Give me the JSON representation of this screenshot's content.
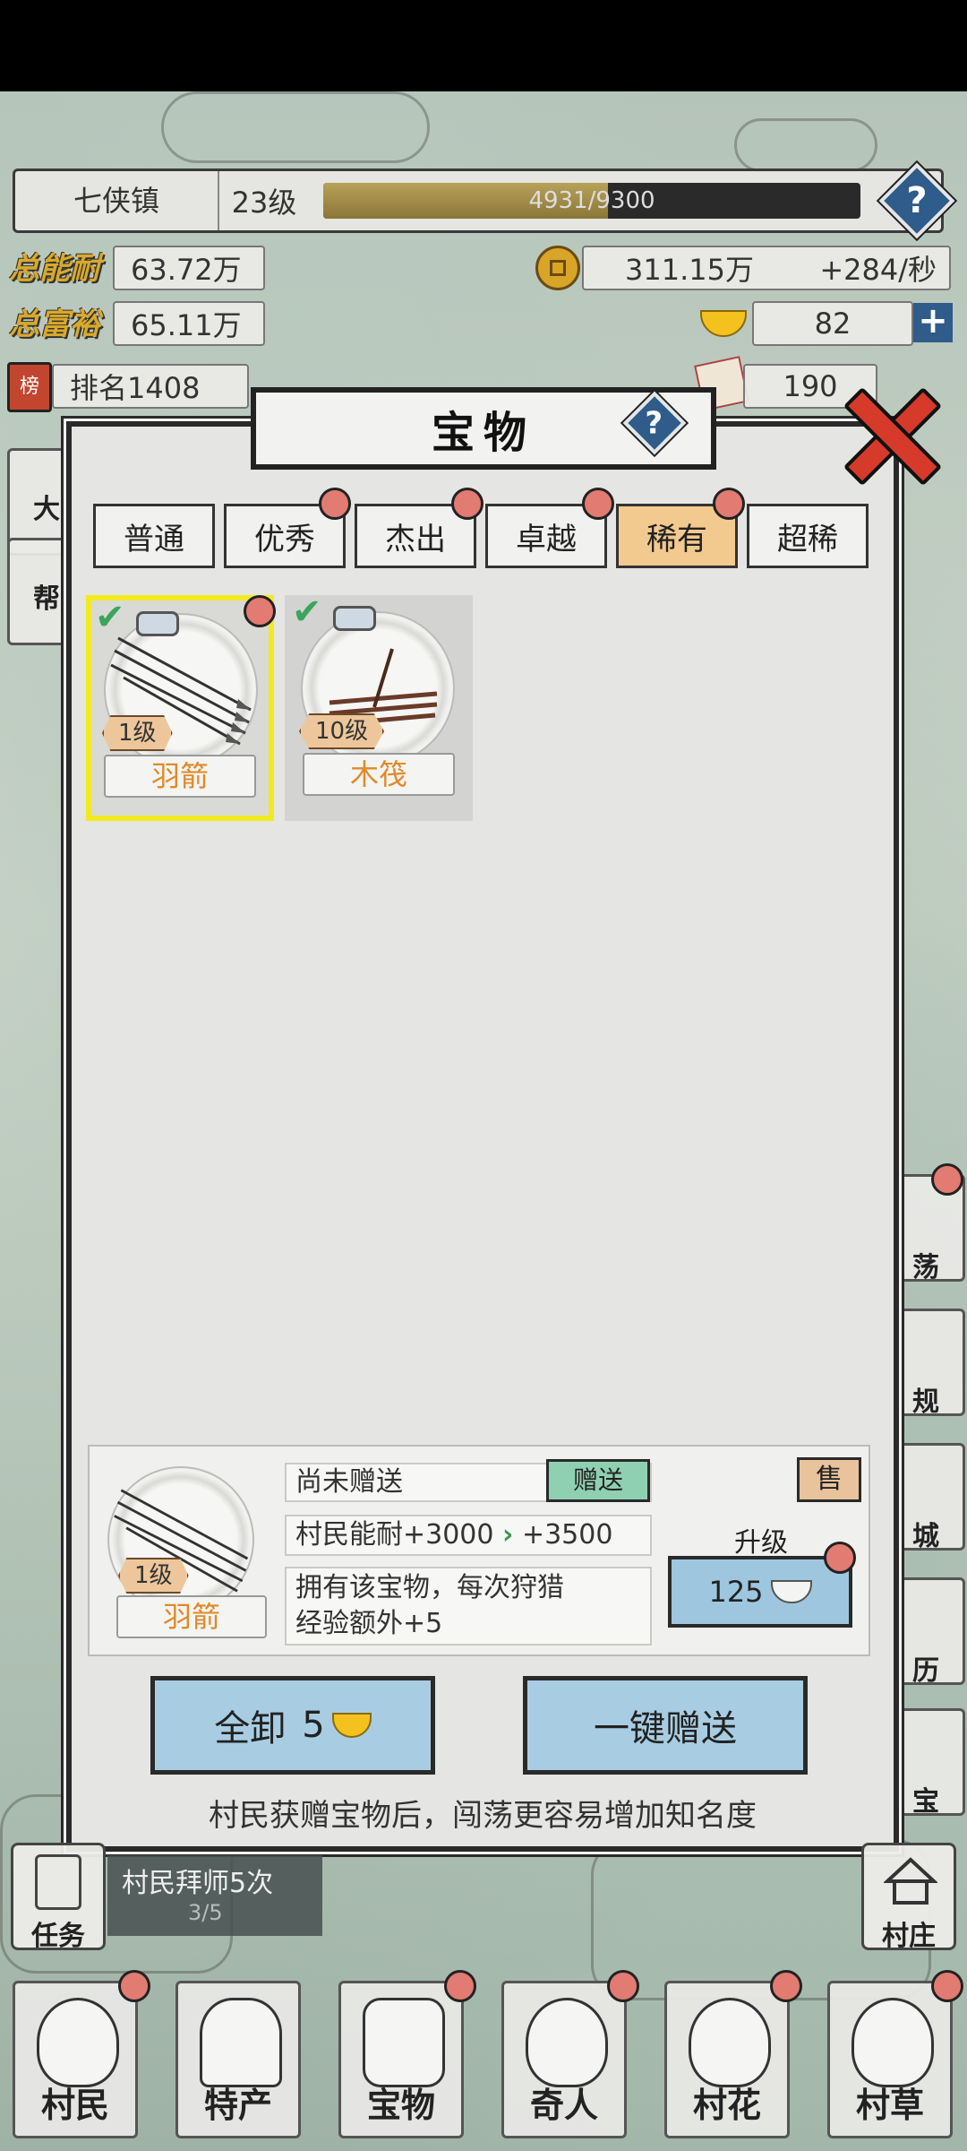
{
  "hud": {
    "town_name": "七侠镇",
    "level": "23级",
    "xp_text": "4931/9300",
    "xp_progress": 0.53,
    "total_ability_label": "总能耐",
    "total_ability_value": "63.72万",
    "total_wealth_label": "总富裕",
    "total_wealth_value": "65.11万",
    "coins_value": "311.15万",
    "coins_rate": "+284/秒",
    "ingots_value": "82",
    "rank_badge": "榜",
    "rank_text": "排名1408",
    "tickets_value": "190"
  },
  "dialog": {
    "title": "宝物",
    "tabs": [
      {
        "label": "普通",
        "dot": false,
        "active": false
      },
      {
        "label": "优秀",
        "dot": true,
        "active": false
      },
      {
        "label": "杰出",
        "dot": true,
        "active": false
      },
      {
        "label": "卓越",
        "dot": true,
        "active": false
      },
      {
        "label": "稀有",
        "dot": true,
        "active": true
      },
      {
        "label": "超稀",
        "dot": false,
        "active": false
      }
    ],
    "items": [
      {
        "name": "羽箭",
        "level": "1级",
        "selected": true,
        "dot": true
      },
      {
        "name": "木筏",
        "level": "10级",
        "selected": false,
        "dot": false
      }
    ],
    "detail": {
      "item_name": "羽箭",
      "item_level": "1级",
      "gift_status": "尚未赠送",
      "gift_button": "赠送",
      "sell_button": "售",
      "stat_text": "村民能耐+3000",
      "stat_next": "+3500",
      "description_line1": "拥有该宝物，每次狩猎",
      "description_line2": "经验额外+5",
      "upgrade_label": "升级",
      "upgrade_cost": "125"
    },
    "unequip_all_label": "全卸",
    "unequip_all_cost": "5",
    "gift_all_label": "一键赠送",
    "hint": "村民获赠宝物后，闯荡更容易增加知名度"
  },
  "side_buttons_left": [
    {
      "label": "大"
    },
    {
      "label": "帮"
    }
  ],
  "side_buttons_right": [
    {
      "label": "荡"
    },
    {
      "label": "规"
    },
    {
      "label": "城"
    },
    {
      "label": "历"
    },
    {
      "label": "宝"
    }
  ],
  "bottom": {
    "task_label": "任务",
    "quest_text": "村民拜师5次",
    "quest_progress": "3/5",
    "village_label": "村庄",
    "nav": [
      {
        "label": "村民",
        "dot": true
      },
      {
        "label": "特产",
        "dot": false
      },
      {
        "label": "宝物",
        "dot": true
      },
      {
        "label": "奇人",
        "dot": true
      },
      {
        "label": "村花",
        "dot": true
      },
      {
        "label": "村草",
        "dot": true
      }
    ]
  }
}
